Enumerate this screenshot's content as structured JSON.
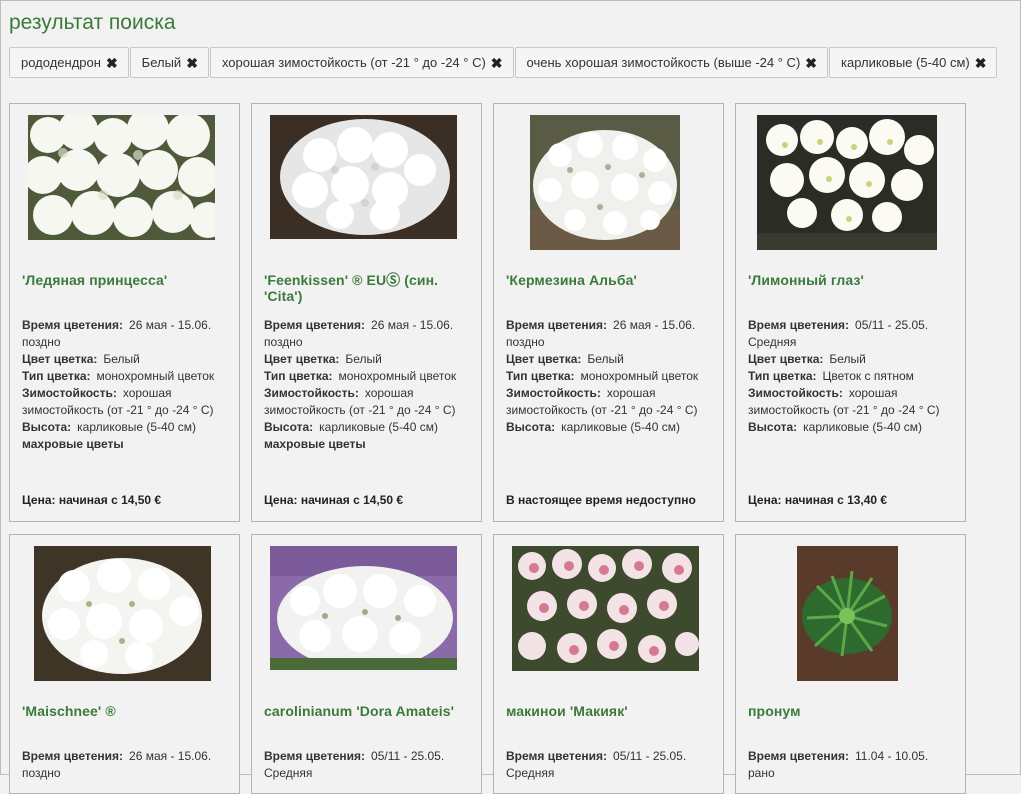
{
  "page": {
    "title": "результат поиска"
  },
  "filters": [
    {
      "label": "рододендрон"
    },
    {
      "label": "Белый"
    },
    {
      "label": "хорошая зимостойкость (от -21 ° до -24 ° C)"
    },
    {
      "label": "очень хорошая зимостойкость (выше -24 ° C)"
    },
    {
      "label": "карликовые (5-40 см)"
    }
  ],
  "labels": {
    "bloom": "Время цветения:",
    "color": "Цвет цветка:",
    "type": "Тип цветка:",
    "hardiness": "Зимостойкость:",
    "height": "Высота:"
  },
  "icons": {
    "remove_filter": "close-icon"
  },
  "colors": {
    "accent": "#3a7a3a",
    "background": "#f2f2f2"
  },
  "products": [
    {
      "name": "'Ледяная принцесса'",
      "bloom": "26 мая - 15.06.",
      "bloom_note": "поздно",
      "color": "Белый",
      "type": "монохромный цветок",
      "hardiness": "хорошая",
      "hardiness_note": "зимостойкость (от -21 ° до -24 ° C)",
      "height": "карликовые (5-40 см)",
      "extra": "махровые цветы",
      "price": "Цена: начиная с 14,50 €"
    },
    {
      "name": "'Feenkissen' ® EUⓈ (син. 'Cita')",
      "bloom": "26 мая - 15.06.",
      "bloom_note": "поздно",
      "color": "Белый",
      "type": "монохромный цветок",
      "hardiness": "хорошая",
      "hardiness_note": "зимостойкость (от -21 ° до -24 ° C)",
      "height": "карликовые (5-40 см)",
      "extra": "махровые цветы",
      "price": "Цена: начиная с 14,50 €"
    },
    {
      "name": "'Кермезина Альба'",
      "bloom": "26 мая - 15.06.",
      "bloom_note": "поздно",
      "color": "Белый",
      "type": "монохромный цветок",
      "hardiness": "хорошая",
      "hardiness_note": "зимостойкость (от -21 ° до -24 ° C)",
      "height": "карликовые (5-40 см)",
      "extra": "",
      "price": "В настоящее время недоступно"
    },
    {
      "name": "'Лимонный глаз'",
      "bloom": "05/11 - 25.05.",
      "bloom_note": "Средняя",
      "color": "Белый",
      "type": "Цветок с пятном",
      "hardiness": "хорошая",
      "hardiness_note": "зимостойкость (от -21 ° до -24 ° C)",
      "height": "карликовые (5-40 см)",
      "extra": "",
      "price": "Цена: начиная с 13,40 €"
    },
    {
      "name": "'Maischnee' ®",
      "bloom": "26 мая - 15.06.",
      "bloom_note": "поздно"
    },
    {
      "name": "carolinianum 'Dora Amateis'",
      "bloom": "05/11 - 25.05.",
      "bloom_note": "Средняя"
    },
    {
      "name": "макинои 'Макияк'",
      "bloom": "05/11 - 25.05.",
      "bloom_note": "Средняя"
    },
    {
      "name": "пронум",
      "bloom": "11.04 - 10.05.",
      "bloom_note": "рано"
    }
  ]
}
